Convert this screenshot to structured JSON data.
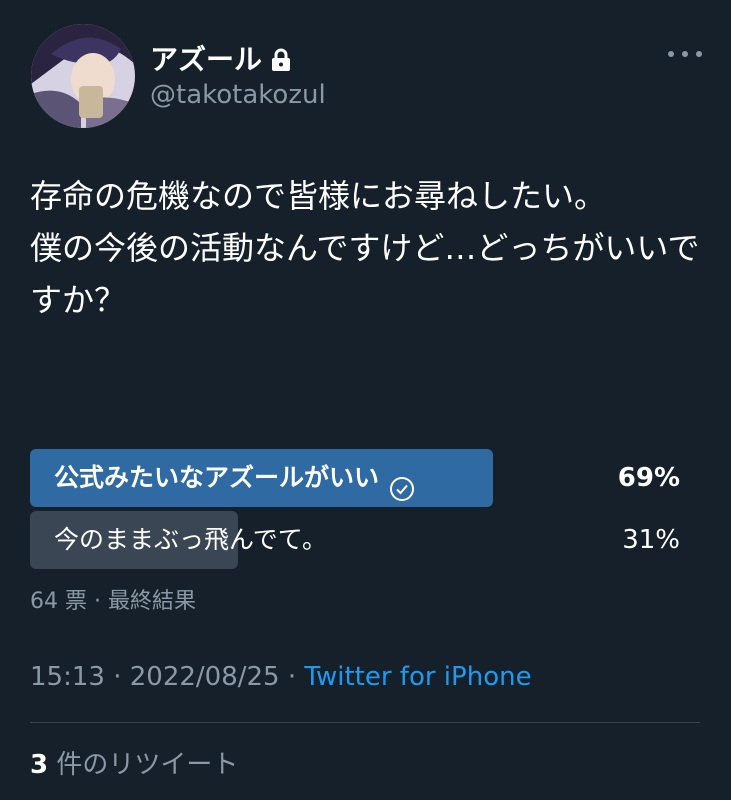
{
  "user": {
    "display_name": "アズール",
    "handle": "@takotakozul",
    "protected_icon": "lock-icon",
    "avatar": "anime-character-avatar"
  },
  "tweet": {
    "text": "存命の危機なので皆様にお尋ねしたい。\n僕の今後の活動なんですけど…どっちがいいですか？"
  },
  "poll": {
    "options": [
      {
        "label": "公式みたいなアズールがいい",
        "percent_text": "69%",
        "percent": 69,
        "selected": true
      },
      {
        "label": "今のままぶっ飛んでて。",
        "percent_text": "31%",
        "percent": 31,
        "selected": false
      }
    ],
    "summary": "64 票 · 最終結果"
  },
  "meta": {
    "time": "15:13",
    "separator": " · ",
    "date": "2022/08/25",
    "source": "Twitter for iPhone"
  },
  "retweets": {
    "count": "3",
    "label": " 件のリツイート"
  },
  "colors": {
    "background": "#15202b",
    "accent": "#1d9bf0",
    "winning_bar": "#2f6aa3",
    "losing_bar": "#3a4653",
    "muted_text": "#8b98a5"
  }
}
